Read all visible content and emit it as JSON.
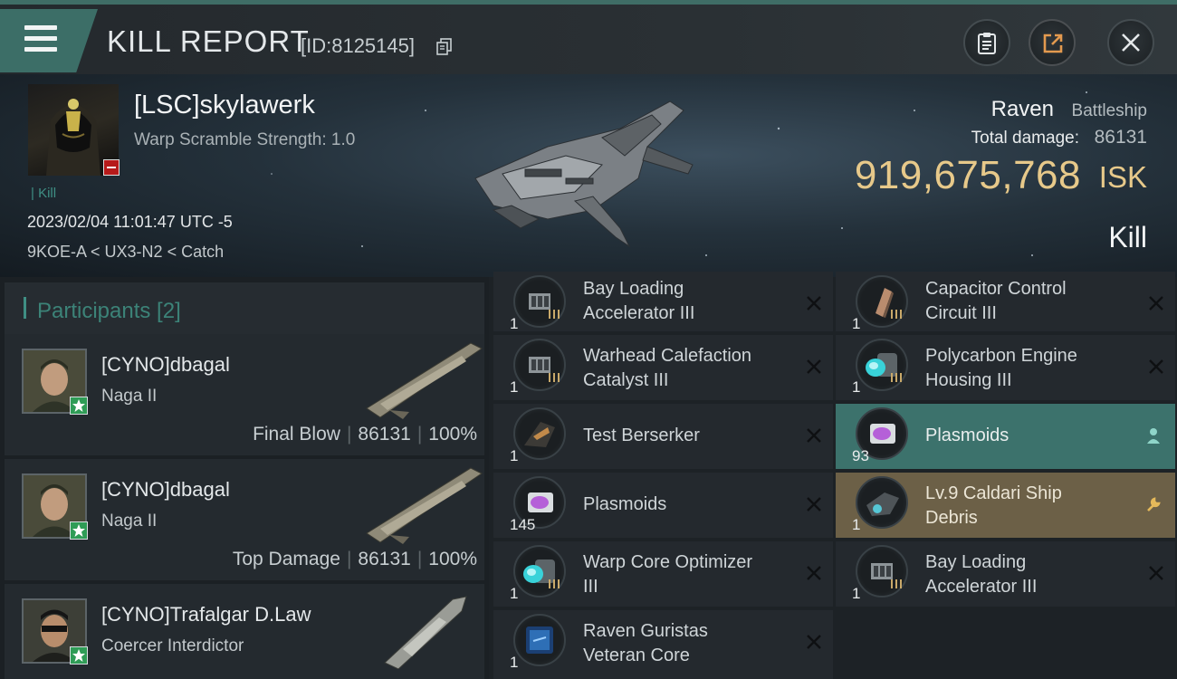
{
  "header": {
    "title": "KILL REPORT",
    "report_id": "[ID:8125145]"
  },
  "victim": {
    "name": "[LSC]skylawerk",
    "warp_scramble": "Warp Scramble Strength: 1.0",
    "tag": "Kill",
    "datetime": "2023/02/04 11:01:47 UTC -5",
    "location": "9KOE-A < UX3-N2 < Catch",
    "ship_name": "Raven",
    "ship_class": "Battleship",
    "total_damage_label": "Total damage:",
    "total_damage": "86131",
    "isk_value": "919,675,768",
    "isk_unit": "ISK",
    "result": "Kill"
  },
  "participants": {
    "title": "Participants [2]",
    "list": [
      {
        "name": "[CYNO]dbagal",
        "ship": "Naga II",
        "role": "Final Blow",
        "damage": "86131",
        "percent": "100%"
      },
      {
        "name": "[CYNO]dbagal",
        "ship": "Naga II",
        "role": "Top Damage",
        "damage": "86131",
        "percent": "100%"
      },
      {
        "name": "[CYNO]Trafalgar D.Law",
        "ship": "Coercer Interdictor"
      }
    ]
  },
  "items": [
    {
      "line1": "Bay Loading",
      "line2": "Accelerator III",
      "qty": "1",
      "state": "destroyed",
      "icon": "launcher-module-icon"
    },
    {
      "line1": "Capacitor Control",
      "line2": "Circuit III",
      "qty": "1",
      "state": "destroyed",
      "icon": "capacitor-rig-icon"
    },
    {
      "line1": "Warhead Calefaction",
      "line2": "Catalyst III",
      "qty": "1",
      "state": "destroyed",
      "icon": "launcher-module-icon"
    },
    {
      "line1": "Polycarbon Engine",
      "line2": "Housing III",
      "qty": "1",
      "state": "destroyed",
      "icon": "engine-rig-icon"
    },
    {
      "line1": "Test Berserker",
      "line2": "",
      "qty": "1",
      "state": "destroyed",
      "icon": "drone-icon"
    },
    {
      "line1": "Plasmoids",
      "line2": "",
      "qty": "93",
      "state": "dropped",
      "icon": "plasmoid-icon"
    },
    {
      "line1": "Plasmoids",
      "line2": "",
      "qty": "145",
      "state": "destroyed",
      "icon": "plasmoid-icon"
    },
    {
      "line1": "Lv.9 Caldari Ship",
      "line2": "Debris",
      "qty": "1",
      "state": "salvage",
      "icon": "debris-icon"
    },
    {
      "line1": "Warp Core Optimizer",
      "line2": "III",
      "qty": "1",
      "state": "destroyed",
      "icon": "engine-rig-icon"
    },
    {
      "line1": "Bay Loading",
      "line2": "Accelerator III",
      "qty": "1",
      "state": "destroyed",
      "icon": "launcher-module-icon"
    },
    {
      "line1": "Raven Guristas",
      "line2": "Veteran Core",
      "qty": "1",
      "state": "destroyed",
      "icon": "core-icon"
    }
  ],
  "colors": {
    "accent_teal": "#3c726c",
    "gold": "#e7c98a",
    "salvage": "#6c6047",
    "kill_red": "#b61a1a"
  }
}
